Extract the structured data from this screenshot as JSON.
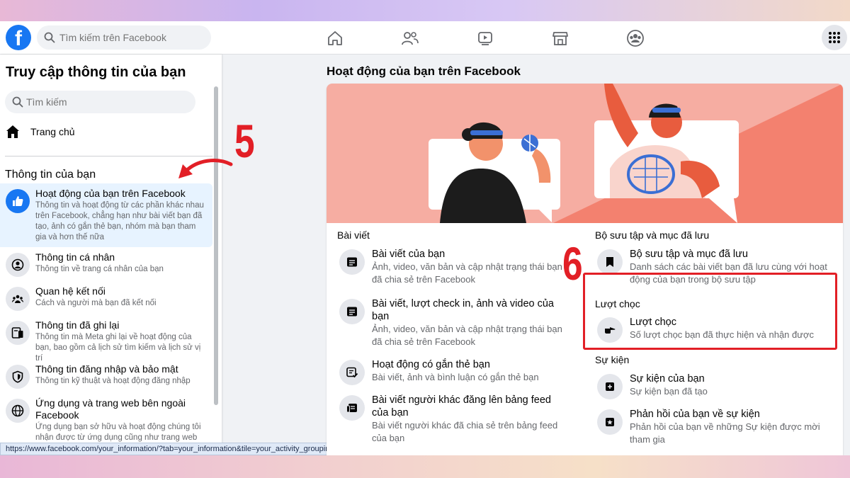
{
  "topbar": {
    "logo": "f",
    "search_placeholder": "Tìm kiếm trên Facebook",
    "nav_icons": [
      "home-icon",
      "friends-icon",
      "watch-icon",
      "marketplace-icon",
      "groups-icon"
    ],
    "menu_icon": "grid-menu-icon"
  },
  "sidebar": {
    "title": "Truy cập thông tin của bạn",
    "search_placeholder": "Tìm kiếm",
    "home_label": "Trang chủ",
    "section_title": "Thông tin của bạn",
    "items": [
      {
        "label": "Hoạt động của bạn trên Facebook",
        "desc": "Thông tin và hoạt động từ các phần khác nhau trên Facebook, chẳng hạn như bài viết bạn đã tạo, ảnh có gắn thẻ bạn, nhóm mà bạn tham gia và hơn thế nữa",
        "icon": "thumbs-up-icon",
        "active": true
      },
      {
        "label": "Thông tin cá nhân",
        "desc": "Thông tin về trang cá nhân của bạn",
        "icon": "profile-icon"
      },
      {
        "label": "Quan hệ kết nối",
        "desc": "Cách và người mà bạn đã kết nối",
        "icon": "connections-icon"
      },
      {
        "label": "Thông tin đã ghi lại",
        "desc": "Thông tin mà Meta ghi lại về hoạt động của bạn, bao gồm cả lịch sử tìm kiếm và lịch sử vị trí",
        "icon": "logged-info-icon"
      },
      {
        "label": "Thông tin đăng nhập và bảo mật",
        "desc": "Thông tin kỹ thuật và hoạt động đăng nhập",
        "icon": "shield-icon"
      },
      {
        "label": "Ứng dụng và trang web bên ngoài Facebook",
        "desc": "Ứng dụng bạn sở hữu và hoạt động chúng tôi nhận được từ ứng dụng cũng như trang web",
        "icon": "globe-icon"
      }
    ]
  },
  "status_url": "https://www.facebook.com/your_information/?tab=your_information&tile=your_activity_grouping",
  "main": {
    "title": "Hoạt động của bạn trên Facebook",
    "left_column": {
      "heading": "Bài viết",
      "entries": [
        {
          "title": "Bài viết của bạn",
          "desc": "Ảnh, video, văn bản và cập nhật trạng thái bạn đã chia sẻ trên Facebook",
          "icon": "post-icon"
        },
        {
          "title": "Bài viết, lượt check in, ảnh và video của bạn",
          "desc": "Ảnh, video, văn bản và cập nhật trạng thái bạn đã chia sẻ trên Facebook",
          "icon": "post-icon"
        },
        {
          "title": "Hoạt động có gắn thẻ bạn",
          "desc": "Bài viết, ảnh và bình luận có gắn thẻ bạn",
          "icon": "tagged-icon"
        },
        {
          "title": "Bài viết người khác đăng lên bảng feed của bạn",
          "desc": "Bài viết người khác đã chia sẻ trên bảng feed của bạn",
          "icon": "feed-icon"
        }
      ]
    },
    "right_column": {
      "collections_heading": "Bộ sưu tập và mục đã lưu",
      "collections_entry": {
        "title": "Bộ sưu tập và mục đã lưu",
        "desc": "Danh sách các bài viết bạn đã lưu cùng với hoạt động của bạn trong bộ sưu tập",
        "icon": "bookmark-icon"
      },
      "pokes_heading": "Lượt chọc",
      "pokes_entry": {
        "title": "Lượt chọc",
        "desc": "Số lượt chọc bạn đã thực hiện và nhận được",
        "icon": "poke-hand-icon"
      },
      "events_heading": "Sự kiện",
      "events_entries": [
        {
          "title": "Sự kiện của bạn",
          "desc": "Sự kiện bạn đã tạo",
          "icon": "event-add-icon"
        },
        {
          "title": "Phản hồi của bạn về sự kiện",
          "desc": "Phản hồi của bạn về những Sự kiện được mời tham gia",
          "icon": "event-star-icon"
        }
      ]
    }
  },
  "annotations": {
    "step_5": "5",
    "step_6": "6",
    "color": "#e21f26"
  },
  "colors": {
    "brand": "#1877f2",
    "banner_bg": "#f6ada2",
    "banner_dark": "#f3816f"
  }
}
